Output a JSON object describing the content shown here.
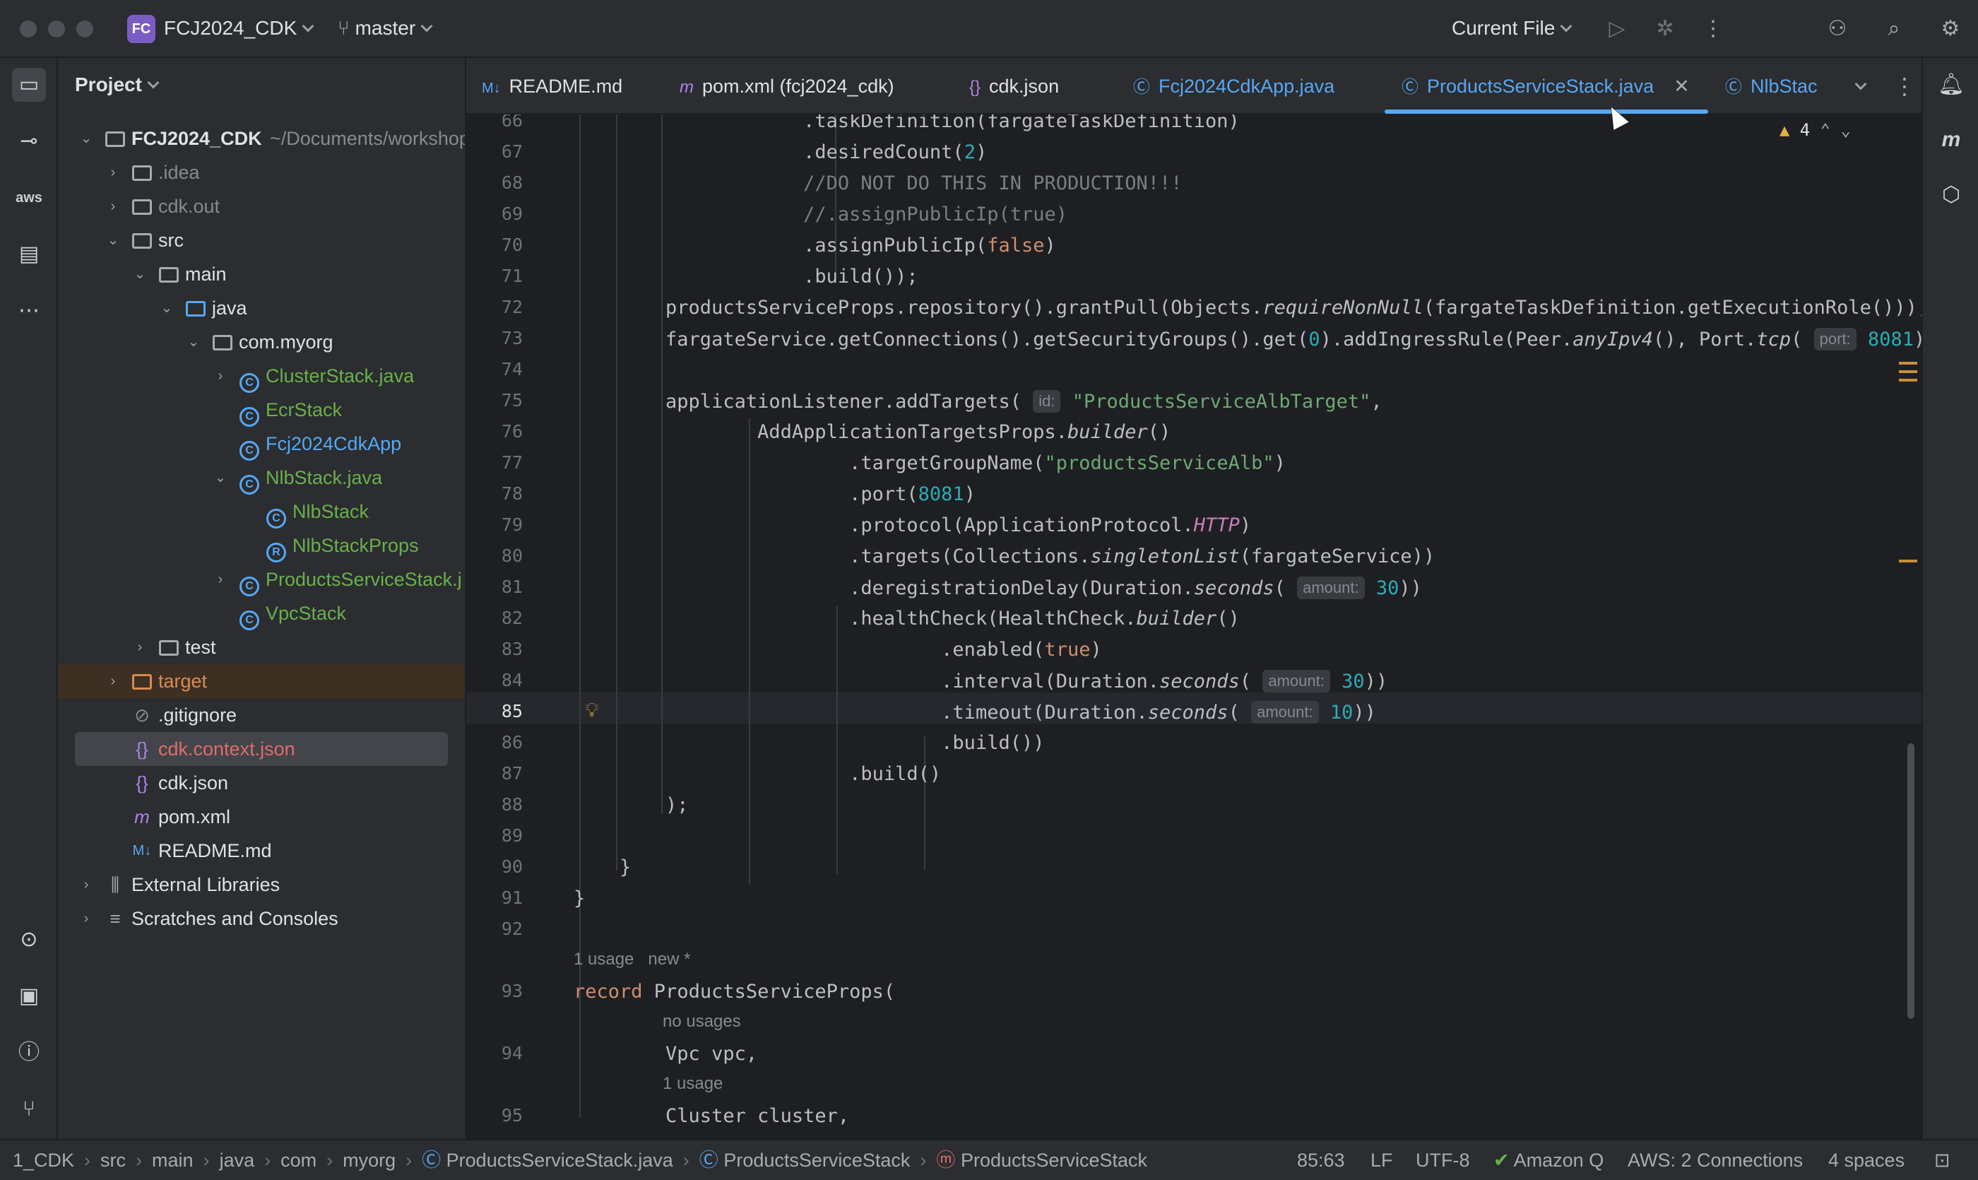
{
  "titlebar": {
    "project_badge": "FC",
    "project_name": "FCJ2024_CDK",
    "branch": "master",
    "run_config": "Current File",
    "icons": [
      "run-icon",
      "debug-icon",
      "more-icon",
      "add-user-icon",
      "search-icon",
      "settings-icon"
    ]
  },
  "project_panel": {
    "title": "Project",
    "tree": [
      {
        "label": "FCJ2024_CDK",
        "extra": "~/Documents/workshop",
        "kind": "root"
      },
      {
        "label": ".idea",
        "kind": "folder"
      },
      {
        "label": "cdk.out",
        "kind": "folder"
      },
      {
        "label": "src",
        "kind": "folder"
      },
      {
        "label": "main",
        "kind": "folder"
      },
      {
        "label": "java",
        "kind": "folder"
      },
      {
        "label": "com.myorg",
        "kind": "package"
      },
      {
        "label": "ClusterStack.java",
        "kind": "class"
      },
      {
        "label": "EcrStack",
        "kind": "class"
      },
      {
        "label": "Fcj2024CdkApp",
        "kind": "class"
      },
      {
        "label": "NlbStack.java",
        "kind": "class"
      },
      {
        "label": "NlbStack",
        "kind": "class"
      },
      {
        "label": "NlbStackProps",
        "kind": "record"
      },
      {
        "label": "ProductsServiceStack.j",
        "kind": "class"
      },
      {
        "label": "VpcStack",
        "kind": "class"
      },
      {
        "label": "test",
        "kind": "folder"
      },
      {
        "label": "target",
        "kind": "folder"
      },
      {
        "label": ".gitignore",
        "kind": "file"
      },
      {
        "label": "cdk.context.json",
        "kind": "json"
      },
      {
        "label": "cdk.json",
        "kind": "json"
      },
      {
        "label": "pom.xml",
        "kind": "maven"
      },
      {
        "label": "README.md",
        "kind": "md"
      },
      {
        "label": "External Libraries",
        "kind": "lib"
      },
      {
        "label": "Scratches and Consoles",
        "kind": "scratch"
      }
    ]
  },
  "tabs": [
    {
      "icon": "M↓",
      "label": "README.md"
    },
    {
      "icon": "m",
      "label": "pom.xml (fcj2024_cdk)"
    },
    {
      "icon": "{}",
      "label": "cdk.json"
    },
    {
      "icon": "Ⓒ",
      "label": "Fcj2024CdkApp.java"
    },
    {
      "icon": "Ⓒ",
      "label": "ProductsServiceStack.java"
    },
    {
      "icon": "Ⓒ",
      "label": "NlbStack"
    }
  ],
  "editor": {
    "warning_count": "4",
    "hints": {
      "usage1": "1 usage   new *",
      "no_usages": "no usages",
      "usage2": "1 usage"
    },
    "inlays": {
      "port": "port:",
      "id": "id:",
      "amount": "amount:"
    },
    "line_numbers": [
      "66",
      "67",
      "68",
      "69",
      "70",
      "71",
      "72",
      "73",
      "74",
      "75",
      "76",
      "77",
      "78",
      "79",
      "80",
      "81",
      "82",
      "83",
      "84",
      "85",
      "86",
      "87",
      "88",
      "89",
      "90",
      "91",
      "92",
      "93",
      "94",
      "95"
    ]
  },
  "statusbar": {
    "crumbs": [
      "1_CDK",
      "src",
      "main",
      "java",
      "com",
      "myorg",
      "ProductsServiceStack.java",
      "ProductsServiceStack",
      "ProductsServiceStack"
    ],
    "position": "85:63",
    "line_sep": "LF",
    "encoding": "UTF-8",
    "amazon_q": "Amazon Q",
    "aws": "AWS: 2 Connections",
    "indent": "4 spaces"
  }
}
